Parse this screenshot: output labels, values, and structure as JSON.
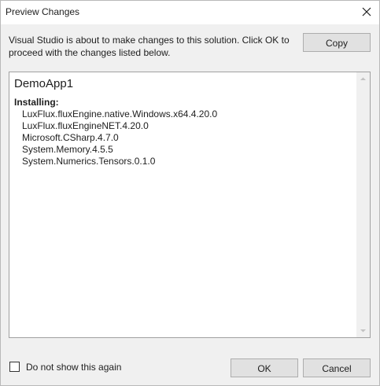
{
  "window": {
    "title": "Preview Changes",
    "close_icon": "close-icon"
  },
  "message": "Visual Studio is about to make changes to this solution. Click OK to proceed with the changes listed below.",
  "buttons": {
    "copy": "Copy",
    "ok": "OK",
    "cancel": "Cancel"
  },
  "changes": {
    "project": "DemoApp1",
    "action": "Installing:",
    "packages": [
      "LuxFlux.fluxEngine.native.Windows.x64.4.20.0",
      "LuxFlux.fluxEngineNET.4.20.0",
      "Microsoft.CSharp.4.7.0",
      "System.Memory.4.5.5",
      "System.Numerics.Tensors.0.1.0"
    ]
  },
  "options": {
    "do_not_show_label": "Do not show this again",
    "do_not_show_checked": false
  }
}
